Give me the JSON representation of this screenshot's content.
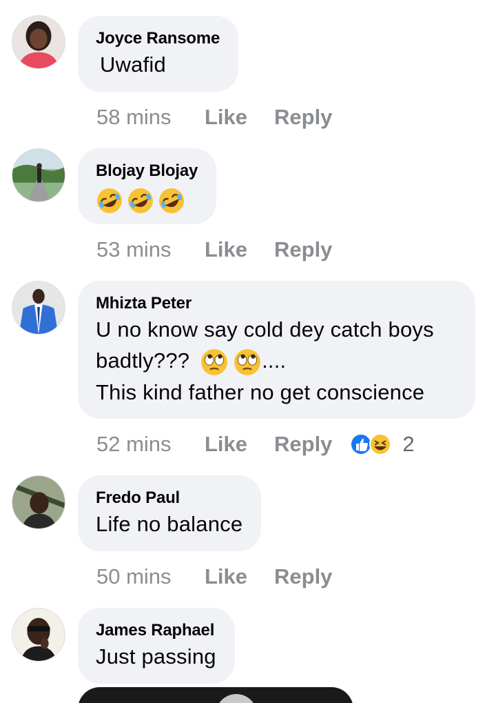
{
  "comments": [
    {
      "author": "Joyce Ransome",
      "text": "Uwafid",
      "time": "58 mins",
      "like_label": "Like",
      "reply_label": "Reply"
    },
    {
      "author": "Blojay Blojay",
      "text": "",
      "emojis": [
        "rofl-emoji",
        "rofl-emoji",
        "rofl-emoji"
      ],
      "time": "53 mins",
      "like_label": "Like",
      "reply_label": "Reply"
    },
    {
      "author": "Mhizta Peter",
      "text_line1": "U no know say cold dey catch boys",
      "text_line2_start": "badtly???",
      "text_line2_end": "....",
      "text_line3": "This kind father no get conscience",
      "time": "52 mins",
      "like_label": "Like",
      "reply_label": "Reply",
      "reaction_count": "2",
      "reactions": [
        "like-reaction-icon",
        "haha-reaction-icon"
      ]
    },
    {
      "author": "Fredo Paul",
      "text": "Life no balance",
      "time": "50 mins",
      "like_label": "Like",
      "reply_label": "Reply"
    },
    {
      "author": "James Raphael",
      "text": "Just passing"
    }
  ],
  "colors": {
    "bubble": "#f0f2f5",
    "meta_text": "#8a8d91",
    "like_blue": "#1877f2",
    "emoji_yellow": "#f7c233"
  }
}
